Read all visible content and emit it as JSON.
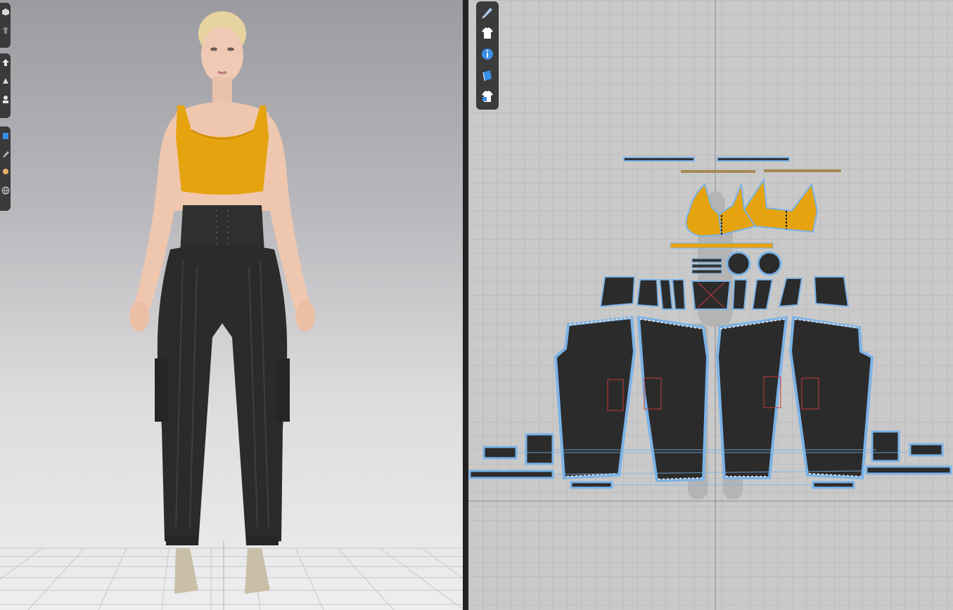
{
  "app": {
    "views": [
      "3d-avatar-window",
      "2d-pattern-window"
    ]
  },
  "toolbar_3d": {
    "group1": [
      "box-icon",
      "garment-fold-icon"
    ],
    "group2": [
      "arrow-up-icon",
      "fitting-icon",
      "avatar-pose-icon"
    ],
    "group3": [
      "texture-brush-icon",
      "pencil-icon",
      "avatar-head-icon",
      "globe-icon"
    ]
  },
  "toolbar_2d": [
    "pen-icon",
    "tshirt-icon",
    "info-icon",
    "book-icon",
    "tshirt-lock-icon"
  ],
  "colors": {
    "top_fabric": "#e6a310",
    "pants_fabric": "#2b2b2b",
    "pattern_outline": "#7ab3e6",
    "stitch_red": "#c83a3a",
    "viewport_bg_top": "#9c9ca0",
    "pattern_bg": "#c9c9c9"
  }
}
